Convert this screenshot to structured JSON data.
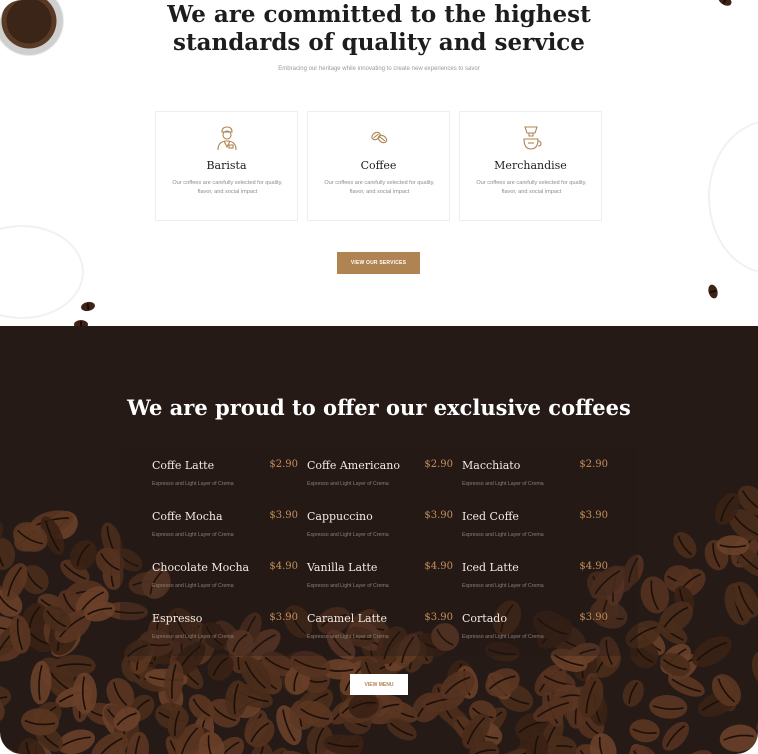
{
  "services": {
    "heading_line1": "We are committed to the highest",
    "heading_line2": "standards of quality and service",
    "subtitle": "Embracing our heritage while innovating to create new experiences to savor",
    "cards": [
      {
        "icon": "barista-icon",
        "title": "Barista",
        "desc": "Our coffees are carefully selected for quality, flavor, and social impact"
      },
      {
        "icon": "coffee-beans-icon",
        "title": "Coffee",
        "desc": "Our coffees are carefully selected for quality, flavor, and social impact"
      },
      {
        "icon": "coffee-maker-icon",
        "title": "Merchandise",
        "desc": "Our coffees are carefully selected for quality, flavor, and social impact"
      }
    ],
    "button_label": "VIEW OUR SERVICES",
    "accent": "#b08353"
  },
  "menu": {
    "heading": "We are proud to offer our exclusive coffees",
    "items": [
      {
        "name": "Coffe Latte",
        "price": "$2.90",
        "desc": "Espresso and Light Layer of Crema"
      },
      {
        "name": "Coffe Americano",
        "price": "$2.90",
        "desc": "Espresso and Light Layer of Crema"
      },
      {
        "name": "Macchiato",
        "price": "$2.90",
        "desc": "Espresso and Light Layer of Crema"
      },
      {
        "name": "Coffe Mocha",
        "price": "$3.90",
        "desc": "Espresso and Light Layer of Crema"
      },
      {
        "name": "Cappuccino",
        "price": "$3.90",
        "desc": "Espresso and Light Layer of Crema"
      },
      {
        "name": "Iced Coffe",
        "price": "$3.90",
        "desc": "Espresso and Light Layer of Crema"
      },
      {
        "name": "Chocolate Mocha",
        "price": "$4.90",
        "desc": "Espresso and Light Layer of Crema"
      },
      {
        "name": "Vanilla Latte",
        "price": "$4.90",
        "desc": "Espresso and Light Layer of Crema"
      },
      {
        "name": "Iced Latte",
        "price": "$4.90",
        "desc": "Espresso and Light Layer of Crema"
      },
      {
        "name": "Espresso",
        "price": "$3.90",
        "desc": "Espresso and Light Layer of Crema"
      },
      {
        "name": "Caramel Latte",
        "price": "$3.90",
        "desc": "Espresso and Light Layer of Crema"
      },
      {
        "name": "Cortado",
        "price": "$3.90",
        "desc": "Espresso and Light Layer of Crema"
      }
    ],
    "button_label": "VIEW MENU",
    "background": "#251a16",
    "price_color": "#c4905d"
  }
}
